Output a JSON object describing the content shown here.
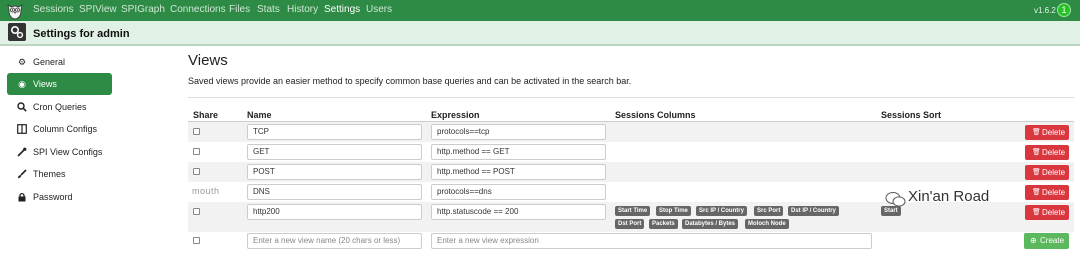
{
  "nav": {
    "items": [
      "Sessions",
      "SPIView",
      "SPIGraph",
      "Connections",
      "Files",
      "Stats",
      "History",
      "Settings",
      "Users"
    ],
    "active": "Settings",
    "version": "v1.6.2",
    "user_initial": "1"
  },
  "header": {
    "title": "Settings for admin"
  },
  "sidebar": {
    "items": [
      {
        "label": "General",
        "icon": "gear-icon"
      },
      {
        "label": "Views",
        "icon": "eye-icon",
        "active": true
      },
      {
        "label": "Cron Queries",
        "icon": "search-icon"
      },
      {
        "label": "Column Configs",
        "icon": "columns-icon"
      },
      {
        "label": "SPI View Configs",
        "icon": "eyedropper-icon"
      },
      {
        "label": "Themes",
        "icon": "paint-brush-icon"
      },
      {
        "label": "Password",
        "icon": "lock-icon"
      }
    ]
  },
  "main": {
    "title": "Views",
    "description": "Saved views provide an easier method to specify common base queries and can be activated in the search bar.",
    "columns": [
      "Share",
      "Name",
      "Expression",
      "Sessions Columns",
      "Sessions Sort"
    ],
    "rows": [
      {
        "name": "TCP",
        "expression": "protocols==tcp",
        "columns": [],
        "sort": ""
      },
      {
        "name": "GET",
        "expression": "http.method == GET",
        "columns": [],
        "sort": ""
      },
      {
        "name": "POST",
        "expression": "http.method == POST",
        "columns": [],
        "sort": ""
      },
      {
        "name": "DNS",
        "expression": "protocols==dns",
        "columns": [],
        "sort": ""
      },
      {
        "name": "http200",
        "expression": "http.statuscode == 200",
        "columns": [
          "Start Time",
          "Stop Time",
          "Src IP / Country",
          "Src Port",
          "Dst IP / Country",
          "Dst Port",
          "Packets",
          "Databytes / Bytes",
          "Moloch Node"
        ],
        "sort": "Start"
      }
    ],
    "delete_label": "Delete",
    "new_name_placeholder": "Enter a new view name (20 chars or less)",
    "new_expression_placeholder": "Enter a new view expression",
    "create_label": "Create"
  },
  "watermark": {
    "left": "mouth",
    "right": "Xin'an Road"
  },
  "colors": {
    "navbar": "#2e8b46",
    "danger": "#d9363e",
    "success": "#5cb85c",
    "tag": "#666666"
  }
}
